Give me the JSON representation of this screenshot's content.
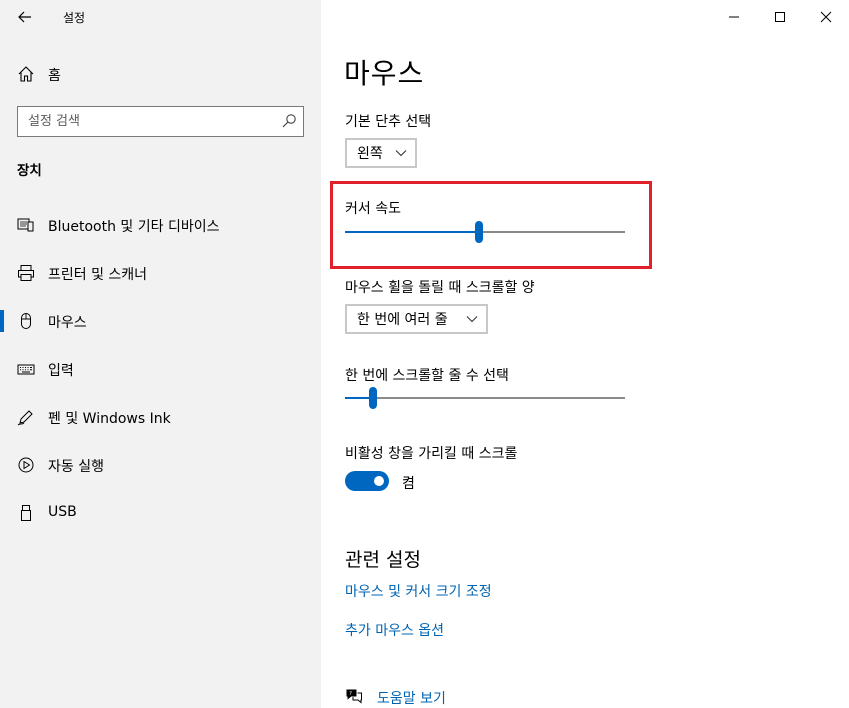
{
  "window": {
    "app_title": "설정"
  },
  "sidebar": {
    "home_label": "홈",
    "search_placeholder": "설정 검색",
    "section_title": "장치",
    "items": [
      {
        "label": "Bluetooth 및 기타 디바이스",
        "icon": "bluetooth-devices-icon"
      },
      {
        "label": "프린터 및 스캐너",
        "icon": "printer-icon"
      },
      {
        "label": "마우스",
        "icon": "mouse-icon",
        "active": true
      },
      {
        "label": "입력",
        "icon": "keyboard-icon"
      },
      {
        "label": "펜 및 Windows Ink",
        "icon": "pen-icon"
      },
      {
        "label": "자동 실행",
        "icon": "autoplay-icon"
      },
      {
        "label": "USB",
        "icon": "usb-icon"
      }
    ]
  },
  "main": {
    "title": "마우스",
    "primary_button": {
      "label": "기본 단추 선택",
      "value": "왼쪽"
    },
    "cursor_speed": {
      "label": "커서 속도",
      "value_fraction": 0.48
    },
    "scroll_amount": {
      "label": "마우스 휠을 돌릴 때 스크롤할 양",
      "value": "한 번에 여러 줄"
    },
    "lines_to_scroll": {
      "label": "한 번에 스크롤할 줄 수 선택",
      "value_fraction": 0.1
    },
    "inactive_scroll": {
      "label": "비활성 창을 가리킬 때 스크롤",
      "state": "켬",
      "on": true
    },
    "related": {
      "title": "관련 설정",
      "links": [
        "마우스 및 커서 크기 조정",
        "추가 마우스 옵션"
      ]
    },
    "help_label": "도움말 보기"
  },
  "colors": {
    "accent": "#0067c0",
    "link": "#0063b1",
    "highlight_box": "#e0202a",
    "sidebar_bg": "#f2f2f2"
  }
}
